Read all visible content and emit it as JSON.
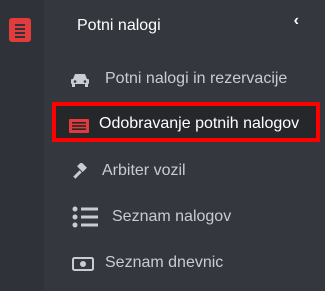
{
  "rail": {
    "icon": "list-doc-icon"
  },
  "header": {
    "title": "Potni nalogi",
    "collapse_icon": "chevron-left-icon",
    "collapse_glyph": "‹"
  },
  "menu": {
    "items": [
      {
        "label": "Potni nalogi in rezervacije",
        "icon": "car-icon"
      },
      {
        "label": "Odobravanje potnih nalogov",
        "icon": "list-card-icon",
        "active": true
      },
      {
        "label": "Arbiter vozil",
        "icon": "gavel-icon"
      },
      {
        "label": "Seznam nalogov",
        "icon": "list-icon"
      },
      {
        "label": "Seznam dnevnic",
        "icon": "money-icon"
      }
    ]
  },
  "colors": {
    "accent": "#e23b3b",
    "highlight_border": "#ff0000",
    "text_active": "#ffffff",
    "text": "#c9ccd2"
  }
}
